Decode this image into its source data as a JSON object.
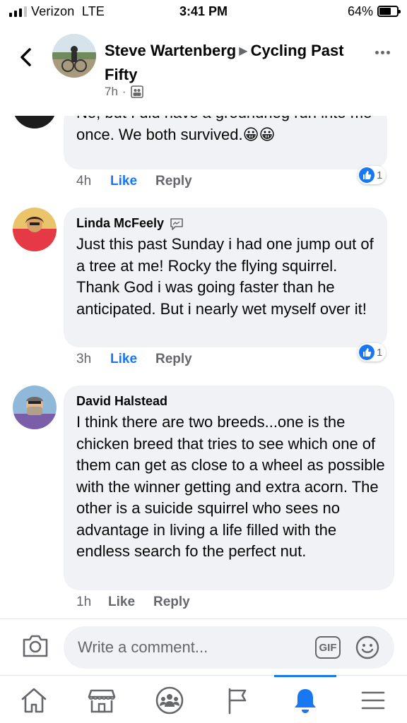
{
  "status_bar": {
    "carrier": "Verizon",
    "network": "LTE",
    "time": "3:41 PM",
    "battery": "64%"
  },
  "header": {
    "author": "Steve Wartenberg",
    "group": "Cycling Past Fifty",
    "time": "7h",
    "separator": "·",
    "privacy_icon": "group-members-icon"
  },
  "comments": [
    {
      "author": "",
      "text": "No, but I did have a groundhog run into me once. We both survived.😀😀",
      "time": "4h",
      "like_label": "Like",
      "reply_label": "Reply",
      "liked": true,
      "reaction_count": "1"
    },
    {
      "author": "Linda McFeely",
      "text": "Just this past Sunday i had one jump out of a tree at me! Rocky the flying squirrel. Thank God i was going faster than he anticipated. But i nearly wet myself over it!",
      "time": "3h",
      "like_label": "Like",
      "reply_label": "Reply",
      "liked": true,
      "reaction_count": "1"
    },
    {
      "author": "David Halstead",
      "text": "I think there are two breeds...one is the chicken breed that tries to see which one of them can get as close to a wheel as possible with the winner getting and extra acorn.  The other is a suicide squirrel who sees no advantage in living a life filled with the endless search fo the perfect nut.",
      "time": "1h",
      "like_label": "Like",
      "reply_label": "Reply",
      "liked": false
    }
  ],
  "composer": {
    "placeholder": "Write a comment...",
    "gif_label": "GIF"
  },
  "bottom_nav": {
    "items": [
      "home-icon",
      "marketplace-icon",
      "groups-icon",
      "pages-flag-icon",
      "notifications-bell-icon",
      "menu-icon"
    ],
    "active": "notifications-bell-icon",
    "accent": "#1877f2"
  }
}
